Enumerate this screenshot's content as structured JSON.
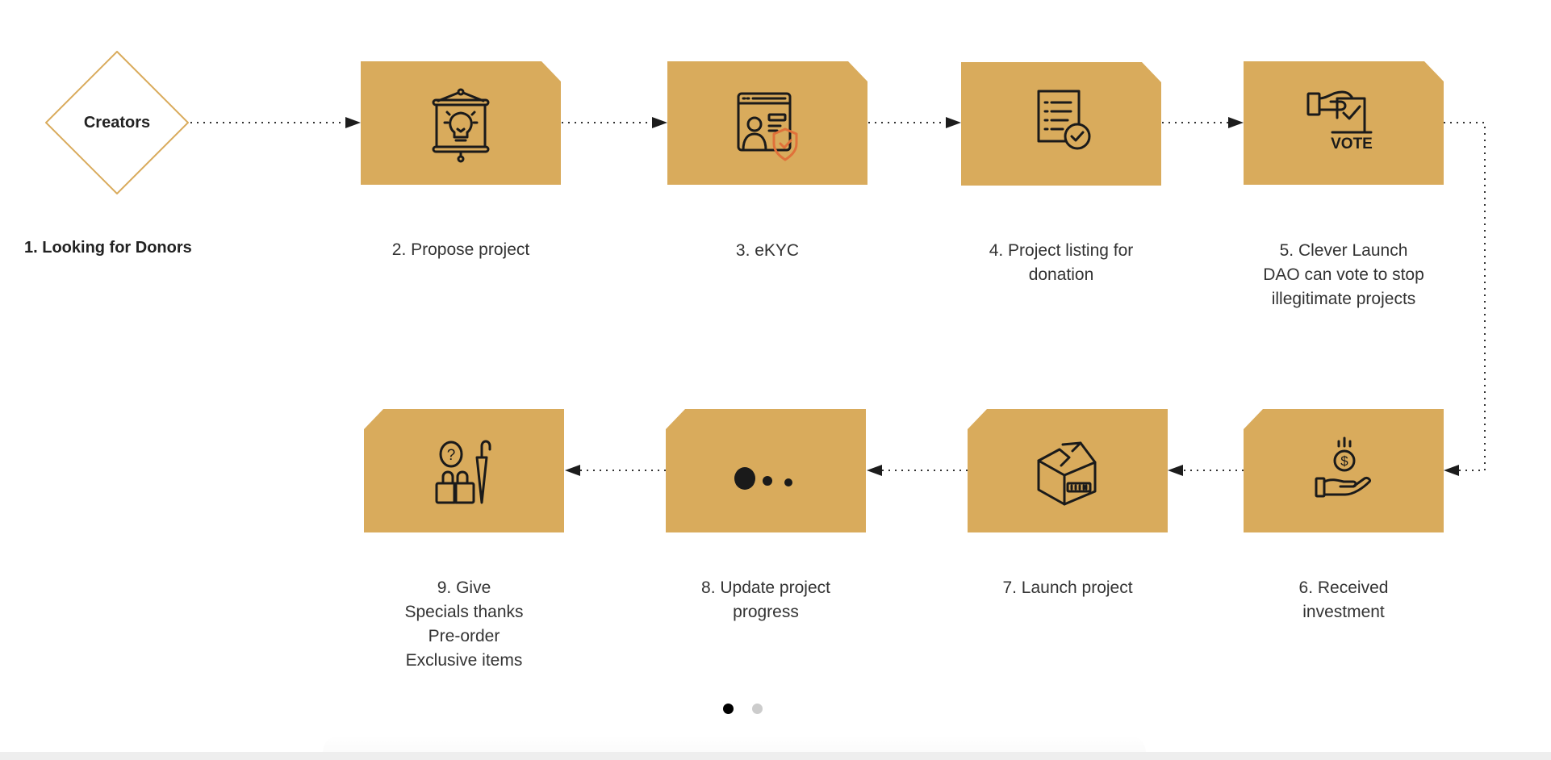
{
  "theme": {
    "box_color": "#D9AB5C",
    "diamond_stroke": "#D9AB5C",
    "icon_color": "#1a1a1a",
    "accent_orange": "#E0713A",
    "connector_color": "#333333",
    "dot_active": "#000000",
    "dot_inactive": "#cccccc"
  },
  "start": {
    "node_label": "Creators",
    "step_label": "1. Looking for Donors"
  },
  "steps": [
    {
      "number": 2,
      "label": "2. Propose project",
      "icon": "presentation-lightbulb-icon"
    },
    {
      "number": 3,
      "label": "3. eKYC",
      "icon": "id-verification-shield-icon"
    },
    {
      "number": 4,
      "label": "4. Project listing for\ndonation",
      "icon": "document-checklist-icon"
    },
    {
      "number": 5,
      "label": "5. Clever Launch\nDAO can vote to stop\nillegitimate projects",
      "icon": "ballot-vote-icon",
      "icon_text": "VOTE"
    },
    {
      "number": 6,
      "label": "6. Received\ninvestment",
      "icon": "hand-money-icon"
    },
    {
      "number": 7,
      "label": "7. Launch project",
      "icon": "package-box-icon"
    },
    {
      "number": 8,
      "label": "8. Update project\nprogress",
      "icon": "progress-dots-icon"
    },
    {
      "number": 9,
      "label": "9. Give\nSpecials thanks\nPre-order\nExclusive items",
      "icon": "gift-rewards-icon"
    }
  ],
  "pagination": {
    "pages": 2,
    "current": 1
  }
}
